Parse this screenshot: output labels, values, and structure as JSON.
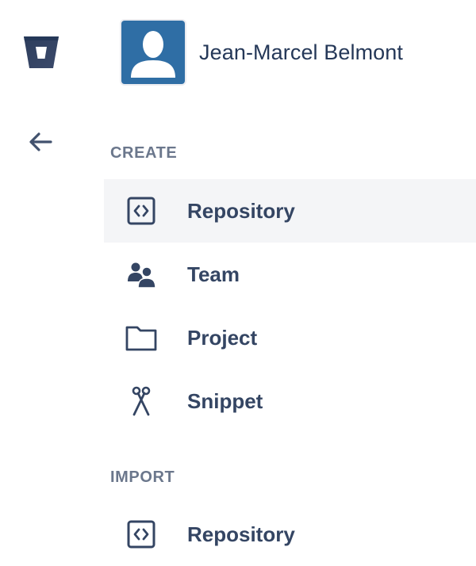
{
  "user": {
    "name": "Jean-Marcel Belmont"
  },
  "sections": {
    "create": {
      "header": "CREATE",
      "items": [
        {
          "label": "Repository",
          "icon": "code-bracket-icon",
          "active": true
        },
        {
          "label": "Team",
          "icon": "team-icon"
        },
        {
          "label": "Project",
          "icon": "folder-icon"
        },
        {
          "label": "Snippet",
          "icon": "scissors-icon"
        }
      ]
    },
    "import": {
      "header": "IMPORT",
      "items": [
        {
          "label": "Repository",
          "icon": "code-bracket-icon"
        }
      ]
    }
  },
  "colors": {
    "brand": "#253858",
    "avatar_bg": "#2f6ea5",
    "text": "#344563",
    "subtle_text": "#6b778c",
    "active_bg": "#f4f5f7"
  }
}
